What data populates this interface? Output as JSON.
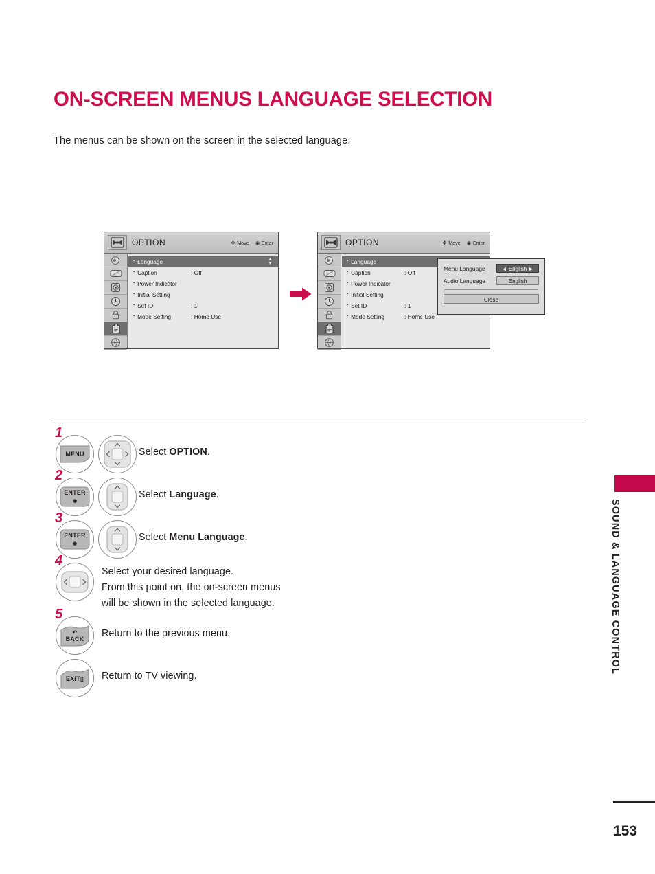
{
  "header": {
    "title": "ON-SCREEN MENUS LANGUAGE SELECTION",
    "subtitle": "The menus can be shown on the screen in the selected language."
  },
  "colors": {
    "accent": "#cd0e4c",
    "tab": "#c4094b",
    "text": "#231f20",
    "osd_background": "#e8e8e8",
    "osd_selected": "#6f6f6f"
  },
  "osd": {
    "title": "OPTION",
    "hints": [
      {
        "glyph": "move-pad-icon",
        "label": "Move"
      },
      {
        "glyph": "enter-dot-icon",
        "label": "Enter"
      }
    ],
    "rail_icons": [
      "audio-speaker-icon",
      "tv-picture-icon",
      "setup-gear-icon",
      "clock-time-icon",
      "lock-icon",
      "option-clipboard-icon",
      "network-globe-icon"
    ],
    "rail_active_index": 5,
    "menu_rows": [
      {
        "label": "Language",
        "value": "",
        "selected": true
      },
      {
        "label": "Caption",
        "value": ": Off",
        "selected": false
      },
      {
        "label": "Power Indicator",
        "value": "",
        "selected": false
      },
      {
        "label": "Initial Setting",
        "value": "",
        "selected": false
      },
      {
        "label": "Set ID",
        "value": ": 1",
        "selected": false
      },
      {
        "label": "Mode Setting",
        "value": ": Home Use",
        "selected": false
      }
    ]
  },
  "language_popup": {
    "menu_language_label": "Menu Language",
    "menu_language_value": "◄ English ►",
    "audio_language_label": "Audio Language",
    "audio_language_value": "English",
    "close_label": "Close"
  },
  "steps": [
    {
      "number": "1",
      "keys": [
        "MENU",
        "nav-pad-4way"
      ],
      "text_plain": "Select ",
      "text_bold": "OPTION",
      "text_tail": "."
    },
    {
      "number": "2",
      "keys": [
        "ENTER",
        "nav-pad-updown"
      ],
      "text_plain": "Select ",
      "text_bold": "Language",
      "text_tail": "."
    },
    {
      "number": "3",
      "keys": [
        "ENTER",
        "nav-pad-updown"
      ],
      "text_plain": "Select ",
      "text_bold": "Menu Language",
      "text_tail": "."
    },
    {
      "number": "4",
      "keys": [
        "nav-pad-leftright"
      ],
      "lines": [
        "Select your desired language.",
        "From this point on, the on-screen menus",
        "will be shown in the selected language."
      ]
    },
    {
      "number": "5",
      "keys": [
        "BACK"
      ],
      "text_plain": "Return to the previous menu."
    },
    {
      "number": "",
      "keys": [
        "EXIT"
      ],
      "text_plain": "Return to TV viewing."
    }
  ],
  "key_labels": {
    "menu": "MENU",
    "enter": "ENTER",
    "back": "BACK",
    "exit": "EXIT"
  },
  "side_tab": {
    "label": "SOUND & LANGUAGE CONTROL"
  },
  "footer": {
    "page_number": "153"
  }
}
